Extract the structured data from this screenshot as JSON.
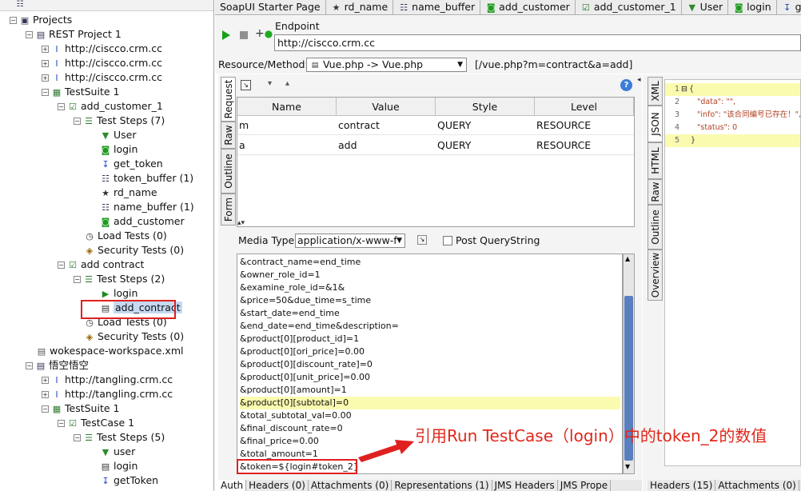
{
  "tree": {
    "toolbar_icon": "list-icon",
    "items": [
      {
        "label": "Projects",
        "icon": "projects-icon",
        "level": 0,
        "expander": "−"
      },
      {
        "label": "REST Project 1",
        "icon": "rest-project-icon",
        "level": 1,
        "expander": "−"
      },
      {
        "label": "http://ciscco.crm.cc",
        "icon": "rest-service-icon",
        "level": 2,
        "expander": "+"
      },
      {
        "label": "http://ciscco.crm.cc",
        "icon": "rest-service-icon",
        "level": 2,
        "expander": "+"
      },
      {
        "label": "http://ciscco.crm.cc",
        "icon": "rest-service-icon",
        "level": 2,
        "expander": "+"
      },
      {
        "label": "TestSuite 1",
        "icon": "testsuite-icon",
        "level": 2,
        "expander": "−"
      },
      {
        "label": "add_customer_1",
        "icon": "testcase-icon",
        "level": 3,
        "expander": "−"
      },
      {
        "label": "Test Steps (7)",
        "icon": "teststeps-icon",
        "level": 4,
        "expander": "−"
      },
      {
        "label": "User",
        "icon": "user-step-icon",
        "level": 5,
        "expander": ""
      },
      {
        "label": "login",
        "icon": "groovy-step-icon",
        "level": 5,
        "expander": ""
      },
      {
        "label": "get_token",
        "icon": "transfer-step-icon",
        "level": 5,
        "expander": ""
      },
      {
        "label": "token_buffer (1)",
        "icon": "properties-step-icon",
        "level": 5,
        "expander": ""
      },
      {
        "label": "rd_name",
        "icon": "star-step-icon",
        "level": 5,
        "expander": ""
      },
      {
        "label": "name_buffer (1)",
        "icon": "properties-step-icon",
        "level": 5,
        "expander": ""
      },
      {
        "label": "add_customer",
        "icon": "groovy-step-icon",
        "level": 5,
        "expander": ""
      },
      {
        "label": "Load Tests (0)",
        "icon": "loadtest-icon",
        "level": 4,
        "expander": ""
      },
      {
        "label": "Security Tests (0)",
        "icon": "securitytest-icon",
        "level": 4,
        "expander": ""
      },
      {
        "label": "add contract",
        "icon": "testcase-icon",
        "level": 3,
        "expander": "−"
      },
      {
        "label": "Test Steps (2)",
        "icon": "teststeps-icon",
        "level": 4,
        "expander": "−"
      },
      {
        "label": "login",
        "icon": "runtestcase-step-icon",
        "level": 5,
        "expander": ""
      },
      {
        "label": "add_contract",
        "icon": "rest-request-step-icon",
        "level": 5,
        "expander": "",
        "selected": true
      },
      {
        "label": "Load Tests (0)",
        "icon": "loadtest-icon",
        "level": 4,
        "expander": ""
      },
      {
        "label": "Security Tests (0)",
        "icon": "securitytest-icon",
        "level": 4,
        "expander": ""
      },
      {
        "label": "wokespace-workspace.xml",
        "icon": "workspace-icon",
        "level": 1,
        "expander": ""
      },
      {
        "label": "悟空悟空",
        "icon": "rest-project-icon",
        "level": 1,
        "expander": "−"
      },
      {
        "label": "http://tangling.crm.cc",
        "icon": "rest-service-icon",
        "level": 2,
        "expander": "+"
      },
      {
        "label": "http://tangling.crm.cc",
        "icon": "rest-service-icon",
        "level": 2,
        "expander": "+"
      },
      {
        "label": "TestSuite 1",
        "icon": "testsuite-icon",
        "level": 2,
        "expander": "−"
      },
      {
        "label": "TestCase 1",
        "icon": "testcase-icon",
        "level": 3,
        "expander": "−"
      },
      {
        "label": "Test Steps (5)",
        "icon": "teststeps-icon",
        "level": 4,
        "expander": "−"
      },
      {
        "label": "user",
        "icon": "user-step-icon",
        "level": 5,
        "expander": ""
      },
      {
        "label": "login",
        "icon": "rest-request-step-icon",
        "level": 5,
        "expander": ""
      },
      {
        "label": "getToken",
        "icon": "transfer-step-icon",
        "level": 5,
        "expander": ""
      }
    ]
  },
  "tabs": [
    {
      "label": "SoapUI Starter Page",
      "icon": ""
    },
    {
      "label": "rd_name",
      "icon": "star-step-icon"
    },
    {
      "label": "name_buffer",
      "icon": "properties-step-icon"
    },
    {
      "label": "add_customer",
      "icon": "groovy-step-icon"
    },
    {
      "label": "add_customer_1",
      "icon": "testcase-icon"
    },
    {
      "label": "User",
      "icon": "user-step-icon"
    },
    {
      "label": "login",
      "icon": "groovy-step-icon"
    },
    {
      "label": "get_",
      "icon": "transfer-step-icon"
    }
  ],
  "editor": {
    "endpoint_label": "Endpoint",
    "endpoint_value": "http://ciscco.crm.cc",
    "resource_label": "Resource/Method:",
    "resource_value": "Vue.php -> Vue.php",
    "resource_path": "[/vue.php?m=contract&a=add]",
    "request_tabs": [
      "Request",
      "Raw",
      "Outline",
      "Form"
    ],
    "response_tabs": [
      "XML",
      "JSON",
      "HTML",
      "Raw",
      "Outline",
      "Overview"
    ],
    "params_headers": [
      "Name",
      "Value",
      "Style",
      "Level"
    ],
    "params_rows": [
      [
        "m",
        "contract",
        "QUERY",
        "RESOURCE"
      ],
      [
        "a",
        "add",
        "QUERY",
        "RESOURCE"
      ]
    ],
    "media_type_label": "Media Type",
    "media_type_value": "application/x-www-f",
    "post_query_label": "Post QueryString",
    "body_lines": [
      "&contract_name=end_time",
      "&owner_role_id=1",
      "&examine_role_id=&1&",
      "&price=50&due_time=s_time",
      "&start_date=end_time",
      "&end_date=end_time&description=",
      "&product[0][product_id]=1",
      "&product[0][ori_price]=0.00",
      "&product[0][discount_rate]=0",
      "&product[0][unit_price]=0.00",
      "&product[0][amount]=1",
      "&product[0][subtotal]=0",
      "&total_subtotal_val=0.00",
      "&final_discount_rate=0",
      "&final_price=0.00",
      "&total_amount=1",
      "&token=${login#token_2}"
    ],
    "highlighted_line": 11,
    "bottom_tabs": [
      "Auth",
      "Headers (0)",
      "Attachments (0)",
      "Representations (1)",
      "JMS Headers",
      "JMS Prope"
    ],
    "response_bottom_tabs": [
      "Headers (15)",
      "Attachments (0)",
      "S"
    ]
  },
  "response": {
    "lines": [
      {
        "num": "1",
        "text": "{",
        "marker": "⊟"
      },
      {
        "num": "2",
        "text": "\"data\": \"\",",
        "marker": ""
      },
      {
        "num": "3",
        "text": "\"info\": \"该合同编号已存在！\",",
        "marker": ""
      },
      {
        "num": "4",
        "text": "\"status\": 0",
        "marker": ""
      },
      {
        "num": "5",
        "text": "}",
        "marker": ""
      }
    ]
  },
  "annotation": {
    "text": "引用Run TestCase（login）中的token_2的数值",
    "color": "#e0281b"
  },
  "colors": {
    "selection": "#c6d9f1",
    "highlight_line": "#fbfbb0",
    "annotation": "#e02020"
  }
}
